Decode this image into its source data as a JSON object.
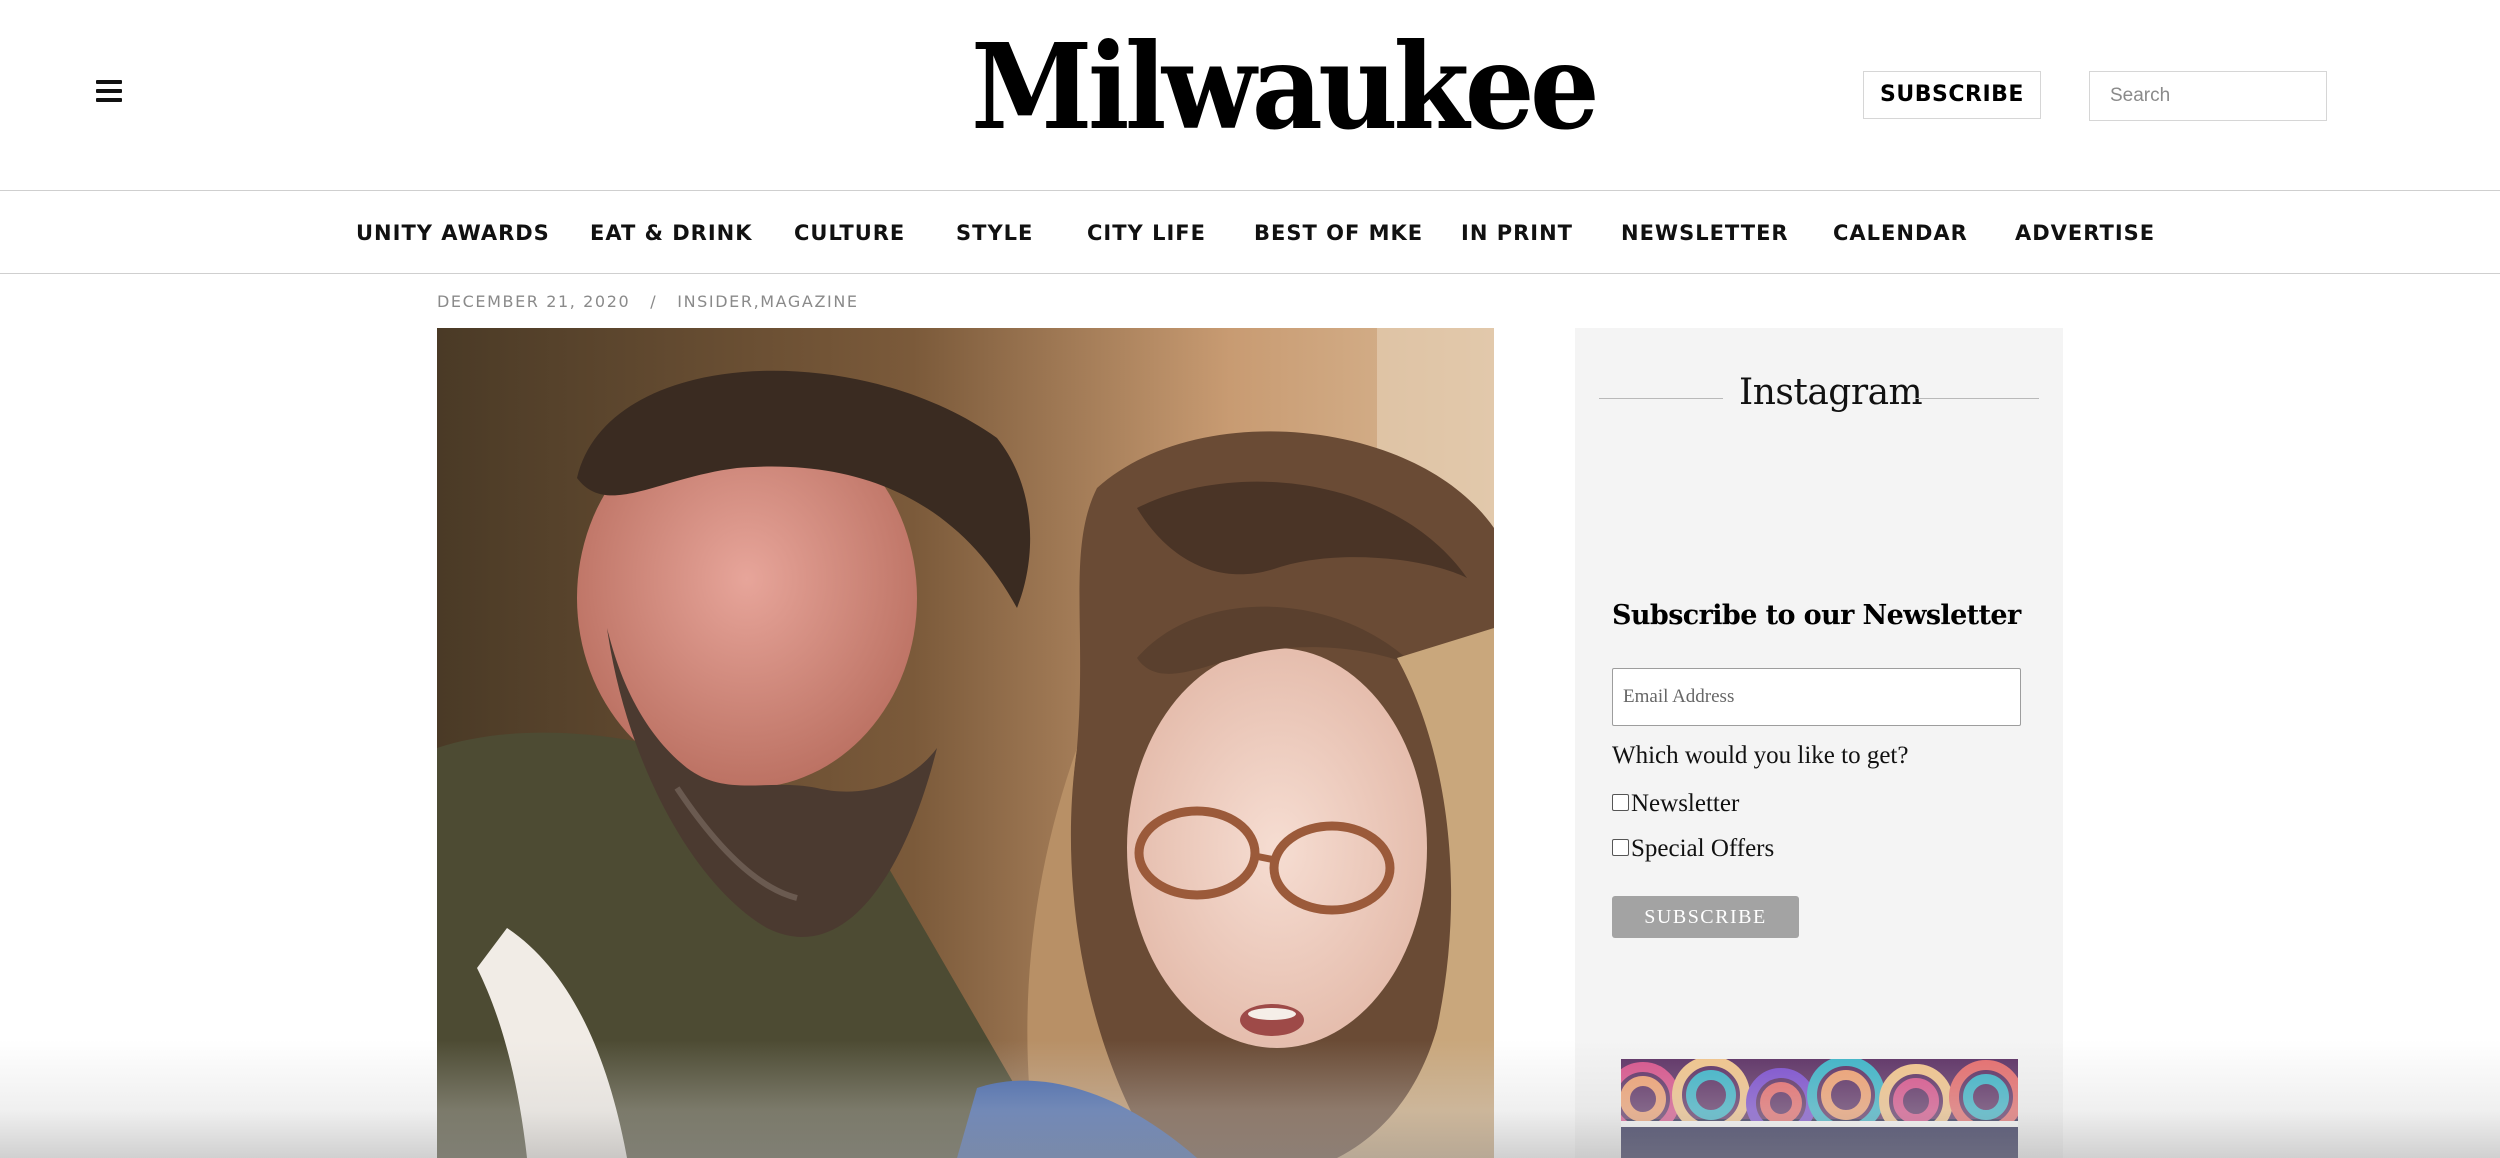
{
  "header": {
    "menu_icon": "hamburger-menu-icon",
    "logo_text": "Milwaukee",
    "subscribe_label": "SUBSCRIBE",
    "search_placeholder": "Search"
  },
  "nav": {
    "items": [
      {
        "label": "UNITY AWARDS"
      },
      {
        "label": "EAT & DRINK"
      },
      {
        "label": "CULTURE"
      },
      {
        "label": "STYLE"
      },
      {
        "label": "CITY LIFE"
      },
      {
        "label": "BEST OF MKE"
      },
      {
        "label": "IN PRINT"
      },
      {
        "label": "NEWSLETTER"
      },
      {
        "label": "CALENDAR"
      },
      {
        "label": "ADVERTISE"
      }
    ]
  },
  "article": {
    "date": "DECEMBER 21, 2020",
    "separator": "/",
    "category_1": "INSIDER",
    "category_2": "MAGAZINE"
  },
  "sidebar": {
    "instagram_title": "Instagram",
    "newsletter": {
      "title": "Subscribe to our Newsletter",
      "email_placeholder": "Email Address",
      "question": "Which would you like to get?",
      "options": [
        {
          "label": "Newsletter",
          "checked": false
        },
        {
          "label": "Special Offers",
          "checked": false
        }
      ],
      "submit_label": "SUBSCRIBE"
    }
  },
  "colors": {
    "text": "#111111",
    "meta_gray": "#8a8a8a",
    "sidebar_bg": "#f4f4f4",
    "button_gray": "#a3a3a3",
    "divider": "#cfcfcf"
  }
}
